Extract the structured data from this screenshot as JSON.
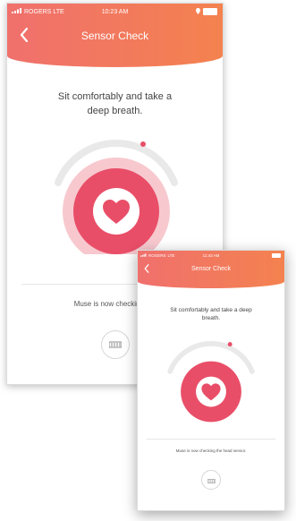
{
  "status_bar": {
    "carrier": "ROGERS",
    "network": "LTE",
    "time": "10:23 AM",
    "small_time": "11:43 AM"
  },
  "screen": {
    "title": "Sensor Check",
    "instruction": "Sit comfortably and take a deep breath.",
    "status_text_large": "Muse is now checking the",
    "status_text_small": "Muse is now checking the head sensor."
  },
  "icons": {
    "back": "chevron-left-icon",
    "heart": "heart-icon",
    "headband": "headband-icon"
  },
  "colors": {
    "header_start": "#f0706d",
    "header_end": "#f4824f",
    "accent": "#e94e68",
    "accent_light": "#f7c9cf",
    "meter_track": "#e9e9e9"
  }
}
